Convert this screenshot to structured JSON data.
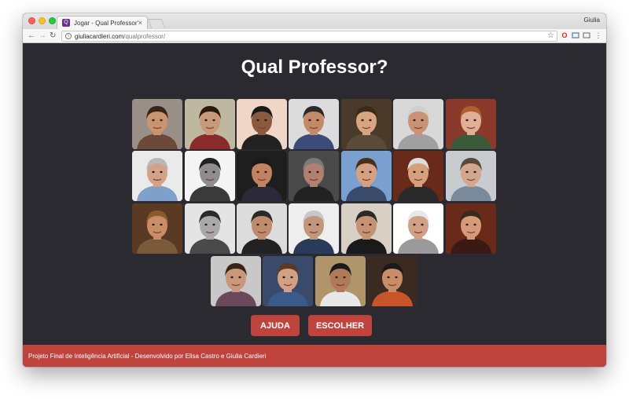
{
  "browser": {
    "tab_title": "Jogar - Qual Professor?",
    "tab_close": "×",
    "favicon_letter": "Q",
    "profile_name": "Giulia",
    "url_host": "giuliacardieri.com",
    "url_path": "/qualprofessor/",
    "icons": [
      "back-arrow-icon",
      "forward-arrow-icon",
      "reload-icon",
      "info-icon",
      "star-icon",
      "opera-icon",
      "extension-icon",
      "cast-icon",
      "menu-icon"
    ]
  },
  "page": {
    "title": "Qual Professor?",
    "help_button": "AJUDA",
    "choose_button": "ESCOLHER",
    "footer_text": "Projeto Final de Inteligência Artificial - Desenvolvido por Elisa Castro e Giulia Cardieri",
    "accent_color": "#c0443e",
    "background_color": "#2b2a30"
  },
  "professor_photos": [
    {
      "bg": "#9a8f86",
      "skin": "#c9946f",
      "hair": "#3a2418",
      "shirt": "#6b4a3a"
    },
    {
      "bg": "#bfb8a0",
      "skin": "#c99a7a",
      "hair": "#2a1a12",
      "shirt": "#8a2a2a"
    },
    {
      "bg": "#f0d6c6",
      "skin": "#8a5a40",
      "hair": "#1a1a1a",
      "shirt": "#222222"
    },
    {
      "bg": "#dcdcdc",
      "skin": "#c48a68",
      "hair": "#2a2a2a",
      "shirt": "#3b4c7a"
    },
    {
      "bg": "#4a3a2a",
      "skin": "#d8a582",
      "hair": "#3a2a1a",
      "shirt": "#5a4a3a"
    },
    {
      "bg": "#d8d8d8",
      "skin": "#c99274",
      "hair": "#cfcfcf",
      "shirt": "#a0a0a0"
    },
    {
      "bg": "#8a3a2a",
      "skin": "#e0b096",
      "hair": "#b06030",
      "shirt": "#3a5a3a"
    },
    {
      "bg": "#eaeaea",
      "skin": "#d2a28a",
      "hair": "#b8b8b8",
      "shirt": "#7fa0c8"
    },
    {
      "bg": "#f4f4f4",
      "skin": "#8e8e8e",
      "hair": "#222222",
      "shirt": "#3a3a3a"
    },
    {
      "bg": "#1e1e1e",
      "skin": "#c18262",
      "hair": "#1a1a1a",
      "shirt": "#2a2a3a"
    },
    {
      "bg": "#4a4a4a",
      "skin": "#b08070",
      "hair": "#7a7a7a",
      "shirt": "#222222"
    },
    {
      "bg": "#7aa0d0",
      "skin": "#d4a283",
      "hair": "#4a2e1a",
      "shirt": "#3a4a6a"
    },
    {
      "bg": "#6a2a1a",
      "skin": "#d6a07c",
      "hair": "#dcdcdc",
      "shirt": "#2a2a2a"
    },
    {
      "bg": "#c8ccd0",
      "skin": "#d1a88e",
      "hair": "#5a4a3a",
      "shirt": "#7a8a9a"
    },
    {
      "bg": "#5a3a22",
      "skin": "#c98e68",
      "hair": "#8a5a2a",
      "shirt": "#7a5a3a"
    },
    {
      "bg": "#e4e4e4",
      "skin": "#a8a8a8",
      "hair": "#2a2a2a",
      "shirt": "#4a4a4a"
    },
    {
      "bg": "#dcdcdc",
      "skin": "#c08a6c",
      "hair": "#2a2a2a",
      "shirt": "#222222"
    },
    {
      "bg": "#eeeeee",
      "skin": "#c2967c",
      "hair": "#c8c8c8",
      "shirt": "#2a3a5a"
    },
    {
      "bg": "#d8d0c4",
      "skin": "#c49274",
      "hair": "#2a2a2a",
      "shirt": "#1a1a1a"
    },
    {
      "bg": "#ffffff",
      "skin": "#d0a084",
      "hair": "#e8e8e8",
      "shirt": "#9a9a9a"
    },
    {
      "bg": "#6a2a1a",
      "skin": "#d49a7a",
      "hair": "#3a2a1a",
      "shirt": "#3a1a14"
    },
    {
      "bg": "#c8c8c8",
      "skin": "#c9977c",
      "hair": "#3a2418",
      "shirt": "#6a4a5a"
    },
    {
      "bg": "#3a4a6a",
      "skin": "#d2a084",
      "hair": "#5a3a22",
      "shirt": "#3a5a8a"
    },
    {
      "bg": "#b0946a",
      "skin": "#b07a5a",
      "hair": "#1a1a1a",
      "shirt": "#e8e8e8"
    },
    {
      "bg": "#3a2a22",
      "skin": "#c98e68",
      "hair": "#1a1a1a",
      "shirt": "#c8552a"
    }
  ]
}
